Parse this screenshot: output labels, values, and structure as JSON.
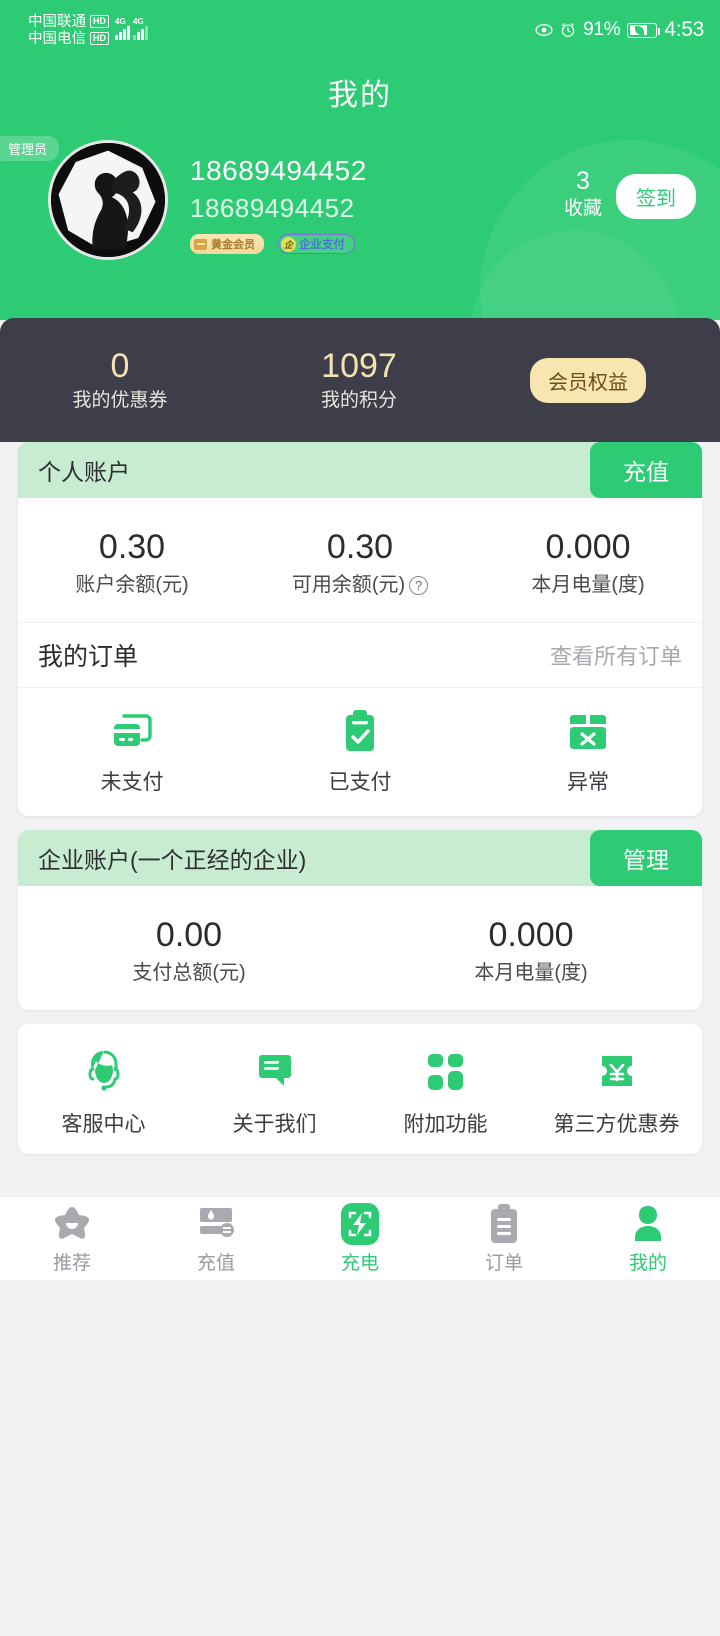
{
  "statusbar": {
    "carrier1": "中国联通",
    "carrier1_hd": "HD",
    "carrier2": "中国电信",
    "carrier2_hd": "HD",
    "net1": "4G",
    "net2": "4G",
    "battery_pct": "91%",
    "time": "4:53",
    "icons": [
      "eye-icon",
      "alarm-icon",
      "battery-icon"
    ]
  },
  "header": {
    "title": "我的",
    "admin_tag": "管理员",
    "bg_color": "#2ccb74"
  },
  "profile": {
    "avatar": "user-avatar",
    "phone_primary": "18689494452",
    "phone_secondary": "18689494452",
    "badge_gold": "黄金会员",
    "badge_enterprise": "企业支付",
    "badge_enterprise_mark": "企",
    "favorites_count": "3",
    "favorites_label": "收藏",
    "signin_label": "签到"
  },
  "stats_card": {
    "bg_color": "#3e3e4a",
    "accent_color": "#f3e2b2",
    "items": [
      {
        "value": "0",
        "label": "我的优惠券"
      },
      {
        "value": "1097",
        "label": "我的积分"
      }
    ],
    "vip_button": "会员权益"
  },
  "personal_account": {
    "title": "个人账户",
    "action_label": "充值",
    "stats": [
      {
        "value": "0.30",
        "label": "账户余额(元)",
        "help": false
      },
      {
        "value": "0.30",
        "label": "可用余额(元)",
        "help": true
      },
      {
        "value": "0.000",
        "label": "本月电量(度)",
        "help": false
      }
    ]
  },
  "orders": {
    "title": "我的订单",
    "view_all": "查看所有订单",
    "items": [
      {
        "label": "未支付",
        "icon": "card-unpaid-icon"
      },
      {
        "label": "已支付",
        "icon": "clipboard-check-icon"
      },
      {
        "label": "异常",
        "icon": "box-error-icon"
      }
    ]
  },
  "enterprise_account": {
    "title": "企业账户(一个正经的企业)",
    "action_label": "管理",
    "stats": [
      {
        "value": "0.00",
        "label": "支付总额(元)"
      },
      {
        "value": "0.000",
        "label": "本月电量(度)"
      }
    ]
  },
  "services": {
    "items": [
      {
        "label": "客服中心",
        "icon": "headset-support-icon"
      },
      {
        "label": "关于我们",
        "icon": "chat-bubble-icon"
      },
      {
        "label": "附加功能",
        "icon": "grid-squares-icon"
      },
      {
        "label": "第三方优惠券",
        "icon": "coupon-yuan-icon"
      }
    ]
  },
  "tabbar": {
    "active": "我的",
    "items": [
      {
        "label": "推荐",
        "icon": "star-icon",
        "active": false
      },
      {
        "label": "充值",
        "icon": "wallet-card-icon",
        "active": false
      },
      {
        "label": "充电",
        "icon": "scan-bolt-icon",
        "active": true
      },
      {
        "label": "订单",
        "icon": "clipboard-icon",
        "active": false
      },
      {
        "label": "我的",
        "icon": "person-icon",
        "active": true
      }
    ]
  },
  "colors": {
    "brand_green": "#2ccb74",
    "header_light_green": "#c7ecd2",
    "dark_card": "#3e3e4a",
    "gold": "#f7e6b0"
  }
}
